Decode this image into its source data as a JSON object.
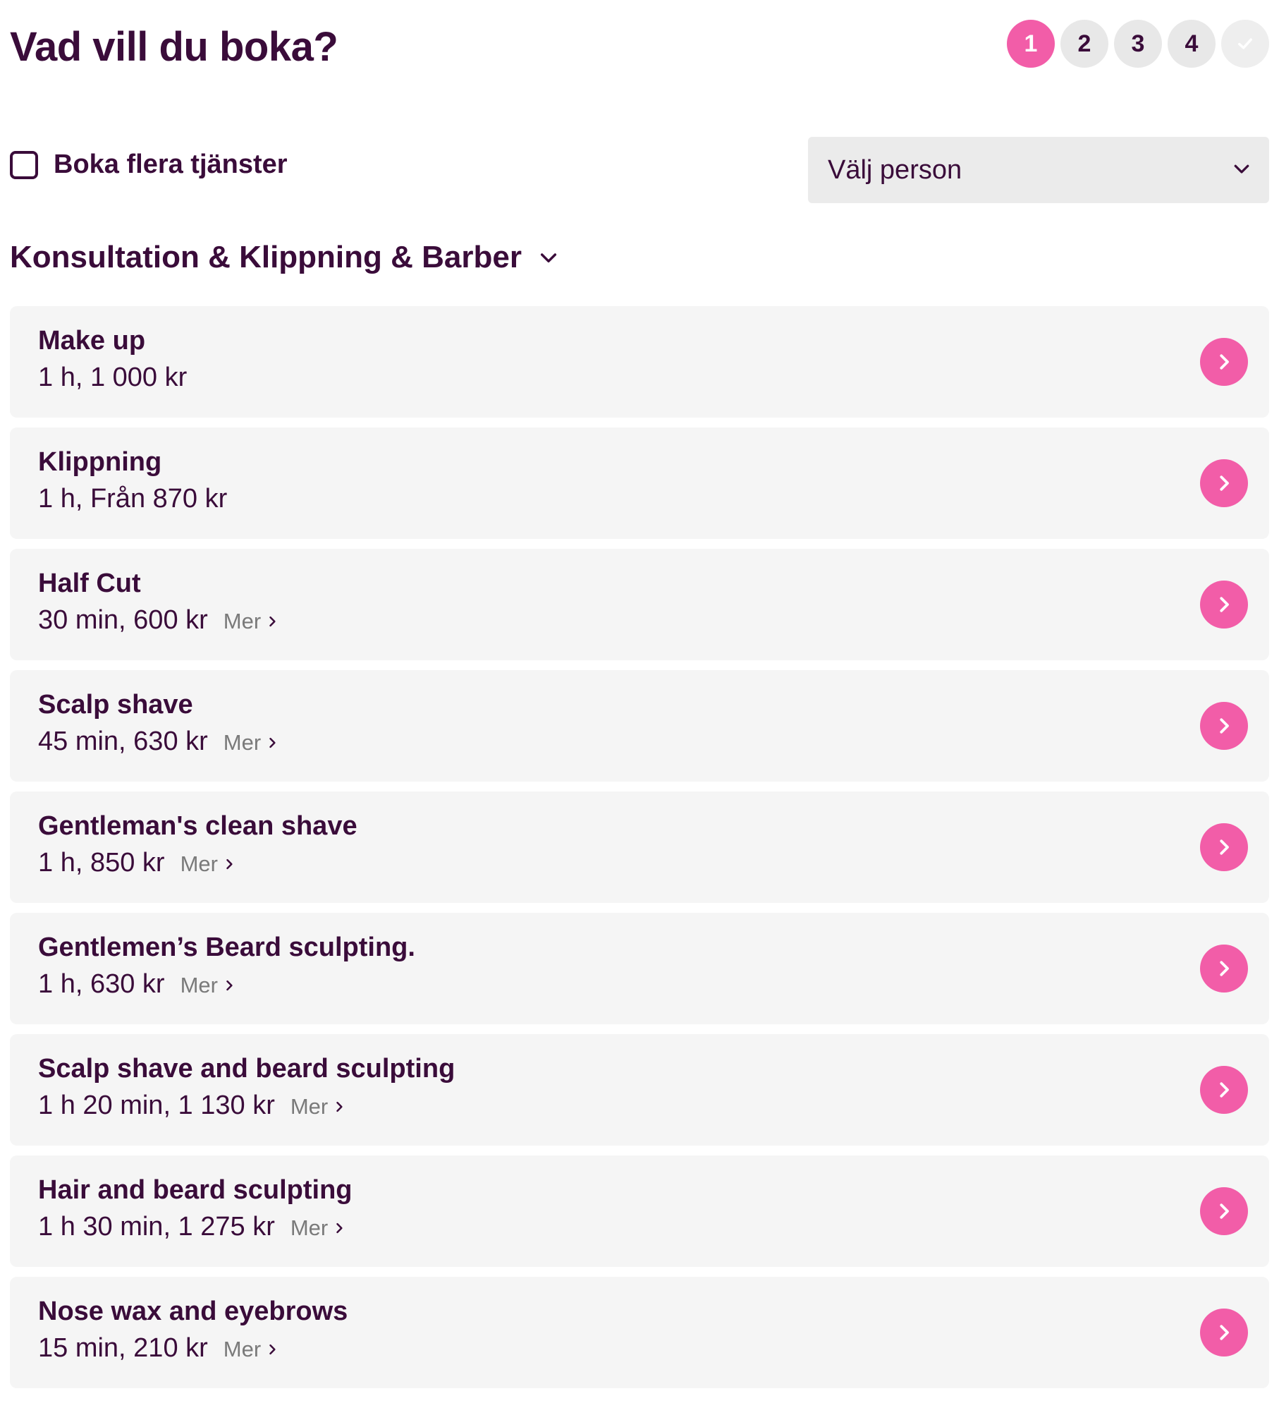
{
  "header": {
    "title": "Vad vill du boka?",
    "steps": [
      {
        "label": "1",
        "state": "active"
      },
      {
        "label": "2",
        "state": "upcoming"
      },
      {
        "label": "3",
        "state": "upcoming"
      },
      {
        "label": "4",
        "state": "upcoming"
      },
      {
        "label": "",
        "state": "done",
        "icon": "check-icon"
      }
    ]
  },
  "controls": {
    "multi_service_label": "Boka flera tjänster",
    "multi_service_checked": false,
    "person_select_value": "Välj person"
  },
  "category": {
    "title": "Konsultation & Klippning & Barber"
  },
  "services": [
    {
      "name": "Make up",
      "details": "1 h, 1 000 kr",
      "more": ""
    },
    {
      "name": "Klippning",
      "details": "1 h, Från 870 kr",
      "more": ""
    },
    {
      "name": "Half Cut",
      "details": "30 min, 600 kr",
      "more": "Mer"
    },
    {
      "name": "Scalp shave",
      "details": "45 min, 630 kr",
      "more": "Mer"
    },
    {
      "name": "Gentleman's clean shave",
      "details": "1 h, 850 kr",
      "more": "Mer"
    },
    {
      "name": "Gentlemen’s Beard sculpting.",
      "details": "1 h, 630 kr",
      "more": "Mer"
    },
    {
      "name": "Scalp shave and beard sculpting",
      "details": "1 h 20 min, 1 130 kr",
      "more": "Mer"
    },
    {
      "name": "Hair and beard sculpting",
      "details": "1 h 30 min, 1 275 kr",
      "more": "Mer"
    },
    {
      "name": "Nose wax and eyebrows",
      "details": "15 min, 210 kr",
      "more": "Mer"
    }
  ],
  "colors": {
    "brand_pink": "#f25da8",
    "text_dark_purple": "#3a0c3a",
    "card_background": "#f5f5f5",
    "step_inactive": "#e8e8e8"
  }
}
